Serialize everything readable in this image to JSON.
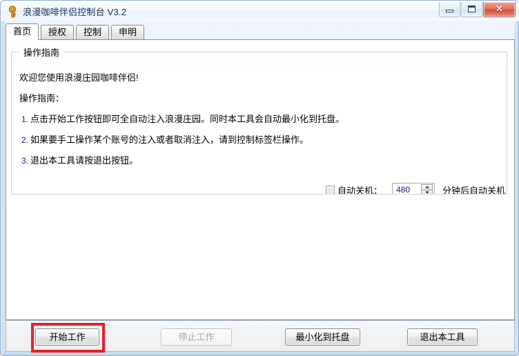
{
  "window": {
    "title": "浪漫咖啡伴侣控制台 V3.2",
    "icon": "key-icon",
    "controls": {
      "minimize": "minimize-icon",
      "maximize": "maximize-icon",
      "close": "✕"
    },
    "accent_close": "#d4503a",
    "border_color": "#8fb3d4"
  },
  "tabs": [
    {
      "label": "首页",
      "active": true
    },
    {
      "label": "授权",
      "active": false
    },
    {
      "label": "控制",
      "active": false
    },
    {
      "label": "申明",
      "active": false
    }
  ],
  "groupbox": {
    "title": "操作指南",
    "welcome": "欢迎您使用浪漫庄园咖啡伴侣!",
    "section_heading": "操作指南：",
    "steps": [
      {
        "num": "1.",
        "text": "点击开始工作按钮即可全自动注入浪漫庄园。同时本工具会自动最小化到托盘。"
      },
      {
        "num": "2.",
        "text": "如果要手工操作某个账号的注入或者取消注入，请到控制标签栏操作。"
      },
      {
        "num": "3.",
        "text": "退出本工具请按退出按钮。"
      }
    ]
  },
  "shutdown": {
    "checkbox_label": "自动关机：",
    "checked": false,
    "minutes_value": "480",
    "suffix_label": "分钟后自动关机",
    "spin_up": "spin-up-icon",
    "spin_down": "spin-down-icon"
  },
  "buttons": [
    {
      "label": "开始工作",
      "enabled": true,
      "highlighted": true
    },
    {
      "label": "停止工作",
      "enabled": false,
      "highlighted": false
    },
    {
      "label": "最小化到托盘",
      "enabled": true,
      "highlighted": false
    },
    {
      "label": "退出本工具",
      "enabled": true,
      "highlighted": false
    }
  ],
  "annotation": {
    "color": "#ee1c25"
  }
}
